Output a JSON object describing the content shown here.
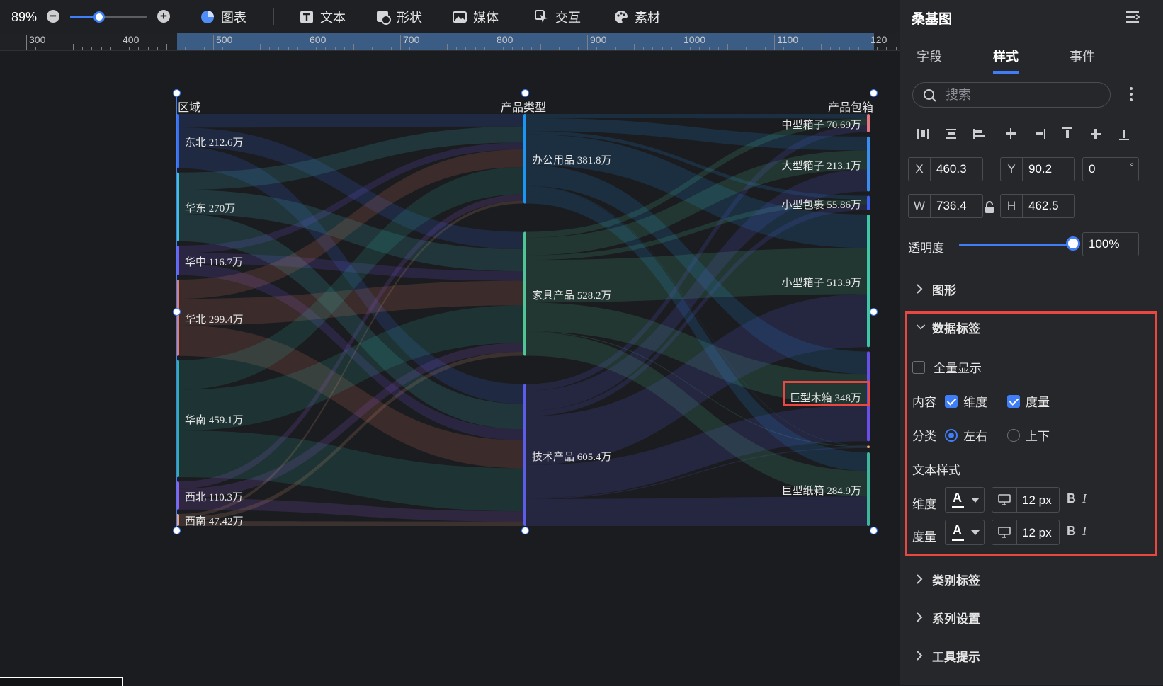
{
  "toolbar": {
    "zoom": "89%",
    "zoom_level": 0.38,
    "items": [
      {
        "label": "图表",
        "icon": "chart-pie-icon"
      },
      {
        "label": "文本",
        "icon": "text-icon"
      },
      {
        "label": "形状",
        "icon": "shape-icon"
      },
      {
        "label": "媒体",
        "icon": "image-icon"
      },
      {
        "label": "交互",
        "icon": "pointer-icon"
      },
      {
        "label": "素材",
        "icon": "palette-icon"
      }
    ]
  },
  "ruler": {
    "labels": [
      "300",
      "400",
      "500",
      "600",
      "700",
      "800",
      "900",
      "1000",
      "1100",
      "120"
    ]
  },
  "chart_data": {
    "type": "sankey",
    "levels": [
      "区域",
      "产品类型",
      "产品包箱"
    ],
    "nodes": [
      {
        "name": "东北",
        "value": "212.6万",
        "level": 0,
        "color": "#3b6ff0"
      },
      {
        "name": "华东",
        "value": "270万",
        "level": 0,
        "color": "#3fc2c8"
      },
      {
        "name": "华中",
        "value": "116.7万",
        "level": 0,
        "color": "#7b5cf0"
      },
      {
        "name": "华北",
        "value": "299.4万",
        "level": 0,
        "color": "#e87a6a"
      },
      {
        "name": "华南",
        "value": "459.1万",
        "level": 0,
        "color": "#2fb3a0"
      },
      {
        "name": "西北",
        "value": "110.3万",
        "level": 0,
        "color": "#9b5ce8"
      },
      {
        "name": "西南",
        "value": "47.42万",
        "level": 0,
        "color": "#e9a27a"
      },
      {
        "name": "办公用品",
        "value": "381.8万",
        "level": 1,
        "color": "#1c95f2"
      },
      {
        "name": "家具产品",
        "value": "528.2万",
        "level": 1,
        "color": "#4fc494"
      },
      {
        "name": "技术产品",
        "value": "605.4万",
        "level": 1,
        "color": "#5b5de8"
      },
      {
        "name": "中型箱子",
        "value": "70.69万",
        "level": 2,
        "color": "#e3767e"
      },
      {
        "name": "大型箱子",
        "value": "213.1万",
        "level": 2,
        "color": "#3b8ef0"
      },
      {
        "name": "小型包裹",
        "value": "55.86万",
        "level": 2,
        "color": "#3b5ff0"
      },
      {
        "name": "小型箱子",
        "value": "513.9万",
        "level": 2,
        "color": "#3fc6a6"
      },
      {
        "name": "巨型木箱",
        "value": "348万",
        "level": 2,
        "color": "#6a4ee8"
      },
      {
        "name": "",
        "value": "",
        "level": 2,
        "color": "#e9a27a"
      },
      {
        "name": "巨型纸箱",
        "value": "284.9万",
        "level": 2,
        "color": "#3fb59b"
      }
    ],
    "highlighted_label": "巨型木箱 348万"
  },
  "panel": {
    "title": "桑基图",
    "tabs": [
      "字段",
      "样式",
      "事件"
    ],
    "active_tab": "样式",
    "search_placeholder": "搜索",
    "x_label": "X",
    "x": "460.3",
    "y_label": "Y",
    "y": "90.2",
    "rotation": "0",
    "rotation_unit": "°",
    "w_label": "W",
    "w": "736.4",
    "h_label": "H",
    "h": "462.5",
    "opacity_label": "透明度",
    "opacity": "100%",
    "opacity_level": 1.0,
    "sections": {
      "graphics": "图形",
      "data_label": "数据标签",
      "category_label": "类别标签",
      "series_settings": "系列设置",
      "tooltip": "工具提示"
    },
    "data_label": {
      "show_all": "全量显示",
      "show_all_checked": false,
      "content_label": "内容",
      "dimension": "维度",
      "dimension_checked": true,
      "measure": "度量",
      "measure_checked": true,
      "layout_label": "分类",
      "left_right": "左右",
      "top_bottom": "上下",
      "layout_selected": "左右",
      "text_style_label": "文本样式",
      "dim_style_label": "维度",
      "dim_size": "12 px",
      "measure_style_label": "度量",
      "measure_size": "12 px",
      "font_color_glyph": "A",
      "bold_glyph": "B",
      "italic_glyph": "I"
    }
  }
}
